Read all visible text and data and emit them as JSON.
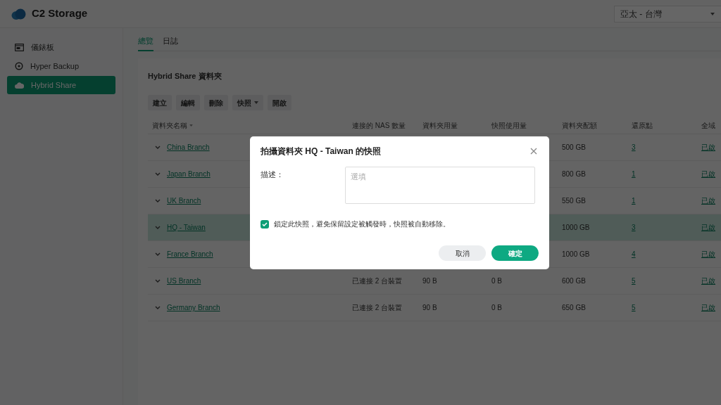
{
  "app": {
    "title": "C2 Storage"
  },
  "region_select": {
    "value": "亞太 - 台灣"
  },
  "sidebar": {
    "items": [
      {
        "label": "儀錶板",
        "selected": false
      },
      {
        "label": "Hyper Backup",
        "selected": false
      },
      {
        "label": "Hybrid Share",
        "selected": true
      }
    ]
  },
  "tabs": [
    {
      "label": "總覽",
      "selected": true
    },
    {
      "label": "日誌",
      "selected": false
    }
  ],
  "section_title": "Hybrid Share 資料夾",
  "toolbar": [
    {
      "label": "建立",
      "dropdown": false
    },
    {
      "label": "編輯",
      "dropdown": false
    },
    {
      "label": "刪除",
      "dropdown": false
    },
    {
      "label": "快照",
      "dropdown": true
    },
    {
      "label": "開啟",
      "dropdown": false
    }
  ],
  "table": {
    "columns": [
      "資料夾名稱",
      "連接的 NAS 數量",
      "資料夾用量",
      "快照使用量",
      "資料夾配額",
      "還原點",
      "全域"
    ],
    "rows": [
      {
        "name": "China Branch",
        "quota": "500 GB",
        "restore_points": "3",
        "global": "已啟",
        "selected": false
      },
      {
        "name": "Japan Branch",
        "quota": "800 GB",
        "restore_points": "1",
        "global": "已啟",
        "selected": false
      },
      {
        "name": "UK Branch",
        "quota": "550 GB",
        "restore_points": "1",
        "global": "已啟",
        "selected": false
      },
      {
        "name": "HQ - Taiwan",
        "quota": "1000 GB",
        "restore_points": "3",
        "global": "已啟",
        "selected": true
      },
      {
        "name": "France Branch",
        "quota": "1000 GB",
        "restore_points": "4",
        "global": "已啟",
        "selected": false
      },
      {
        "name": "US Branch",
        "nas": "已連接 2 台裝置",
        "used": "90 B",
        "snapshot": "0 B",
        "quota": "600 GB",
        "restore_points": "5",
        "global": "已啟",
        "selected": false
      },
      {
        "name": "Germany Branch",
        "nas": "已連接 2 台裝置",
        "used": "90 B",
        "snapshot": "0 B",
        "quota": "650 GB",
        "restore_points": "5",
        "global": "已啟",
        "selected": false
      }
    ]
  },
  "dialog": {
    "title": "拍攝資料夾 HQ - Taiwan 的快照",
    "description_label": "描述：",
    "description_placeholder": "選填",
    "lock_checkbox": {
      "label": "鎖定此快照，避免保留設定被觸發時，快照被自動移除。",
      "checked": true
    },
    "buttons": [
      {
        "label": "取消",
        "kind": "secondary"
      },
      {
        "label": "確定",
        "kind": "primary"
      }
    ]
  }
}
